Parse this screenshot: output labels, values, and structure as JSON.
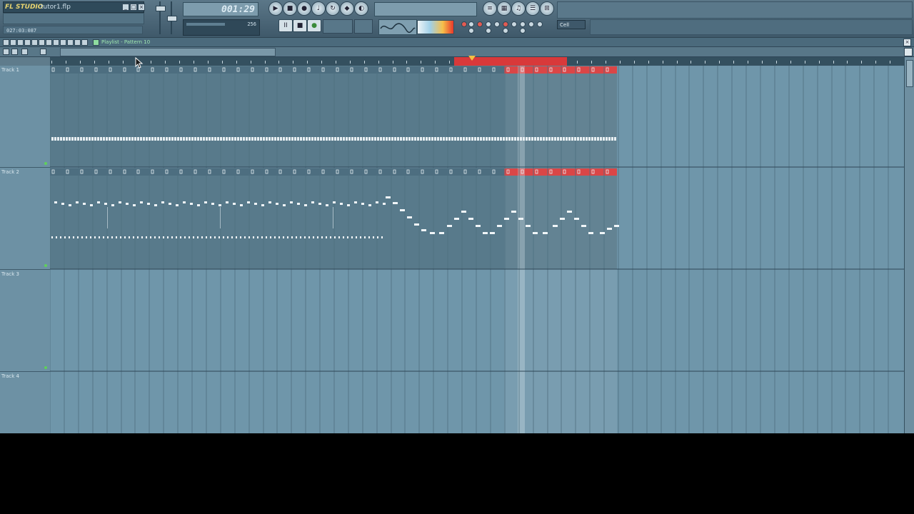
{
  "app": {
    "logo": "FL STUDIO",
    "project_name": "tutor1.flp",
    "time_readout": "027:03:087",
    "song_position": "001:29",
    "cpu_value": "256",
    "cell_select": "Cell"
  },
  "transport": {
    "pause_label": "II",
    "stop_label": "■",
    "record_label": "●"
  },
  "playlist": {
    "title": "Playlist - Pattern 10"
  },
  "tracks": [
    {
      "name": "Track 1",
      "pattern_label": "0"
    },
    {
      "name": "Track 2",
      "pattern_label": "0"
    },
    {
      "name": "Track 3",
      "pattern_label": ""
    },
    {
      "name": "Track 4",
      "pattern_label": ""
    }
  ],
  "colors": {
    "loop_region": "#d8393a",
    "pattern_block": "#587a8b",
    "grid_bg": "#6f96aa",
    "note": "#f0f5f8",
    "song_marker": "#f3c142"
  },
  "icons": {
    "close": "close-icon",
    "play": "play-icon",
    "stop": "stop-icon",
    "pause": "pause-icon",
    "record": "record-icon",
    "marker": "song-position-marker"
  }
}
